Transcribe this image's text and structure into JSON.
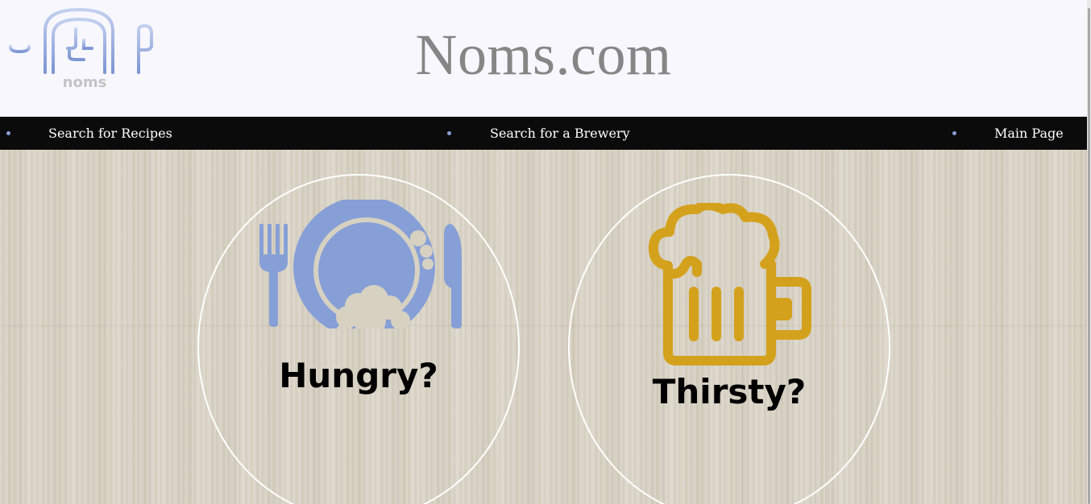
{
  "header": {
    "logo_text": "noms",
    "site_title": "Noms.com"
  },
  "nav": {
    "items": [
      {
        "label": "Search for Recipes"
      },
      {
        "label": "Search for a Brewery"
      },
      {
        "label": "Main Page"
      }
    ],
    "bullet_color": "#8a9ed8"
  },
  "cards": {
    "hungry": {
      "label": "Hungry?",
      "icon": "plate-fork-knife-icon",
      "icon_color": "#869fd6"
    },
    "thirsty": {
      "label": "Thirsty?",
      "icon": "beer-mug-icon",
      "icon_color": "#d4a11c"
    }
  },
  "colors": {
    "header_bg": "#f7f7fd",
    "nav_bg": "#0b0b0b",
    "title_color": "#868686"
  }
}
